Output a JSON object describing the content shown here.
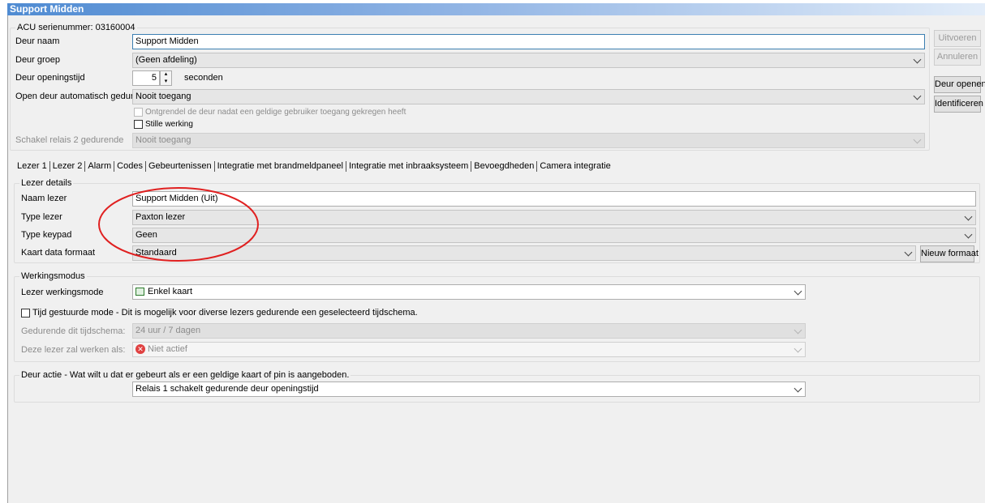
{
  "window": {
    "title": "Support Midden",
    "serial_label": "ACU serienummer: 03160004"
  },
  "door": {
    "name_label": "Deur naam",
    "name_value": "Support Midden",
    "group_label": "Deur groep",
    "group_value": "(Geen afdeling)",
    "open_time_label": "Deur openingstijd",
    "open_time_value": "5",
    "open_time_unit": "seconden",
    "auto_open_label": "Open deur automatisch gedurende",
    "auto_open_value": "Nooit toegang",
    "unlock_after_label": "Ontgrendel de deur nadat een geldige gebruiker toegang gekregen heeft",
    "silent_label": "Stille werking",
    "relay2_label": "Schakel relais 2 gedurende",
    "relay2_value": "Nooit toegang"
  },
  "buttons": {
    "execute": "Uitvoeren",
    "cancel": "Annuleren",
    "open_door": "Deur openen",
    "identify": "Identificeren",
    "new_format": "Nieuw formaat"
  },
  "tabs": [
    {
      "label": "Lezer 1"
    },
    {
      "label": "Lezer 2"
    },
    {
      "label": "Alarm"
    },
    {
      "label": "Codes"
    },
    {
      "label": "Gebeurtenissen"
    },
    {
      "label": "Integratie met brandmeldpaneel"
    },
    {
      "label": "Integratie met inbraaksysteem"
    },
    {
      "label": "Bevoegdheden"
    },
    {
      "label": "Camera integratie"
    }
  ],
  "reader_details": {
    "legend": "Lezer details",
    "name_label": "Naam lezer",
    "name_value": "Support Midden (Uit)",
    "type_label": "Type lezer",
    "type_value": "Paxton lezer",
    "keypad_label": "Type keypad",
    "keypad_value": "Geen",
    "card_format_label": "Kaart data formaat",
    "card_format_value": "Standaard"
  },
  "working_mode": {
    "legend": "Werkingsmodus",
    "mode_label": "Lezer werkingsmode",
    "mode_value": "Enkel kaart",
    "timed_label": "Tijd gestuurde mode - Dit is mogelijk voor diverse lezers gedurende een geselecteerd tijdschema.",
    "schedule_label": "Gedurende dit tijdschema:",
    "schedule_value": "24 uur / 7 dagen",
    "act_as_label": "Deze lezer zal werken als:",
    "act_as_value": "Niet actief"
  },
  "door_action": {
    "legend": "Deur actie - Wat wilt u dat er gebeurt als er een geldige kaart of pin is aangeboden.",
    "value": "Relais 1 schakelt gedurende deur openingstijd"
  },
  "colors": {
    "title_gradient_start": "#4f8bd2",
    "annotation": "#e02020"
  }
}
